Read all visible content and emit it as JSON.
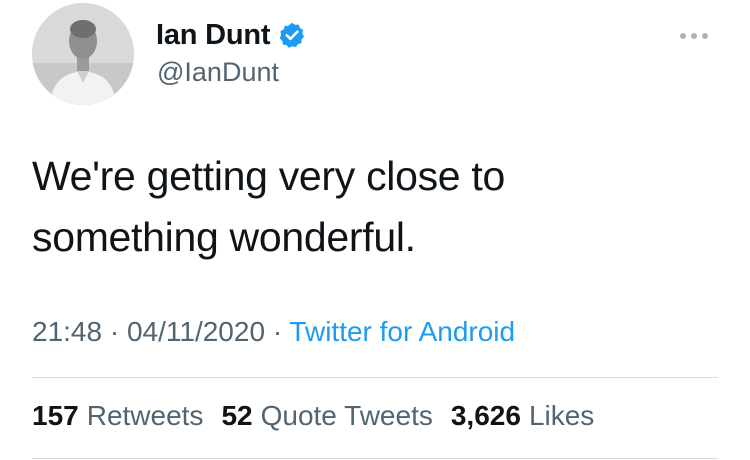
{
  "author": {
    "display_name": "Ian Dunt",
    "handle": "@IanDunt",
    "verified": true,
    "avatar_icon": "profile-photo-grayscale"
  },
  "tweet": {
    "text_lines": [
      "We're getting very close to",
      "something wonderful."
    ]
  },
  "meta": {
    "time": "21:48",
    "date": "04/11/2020",
    "separator": "·",
    "source": "Twitter for Android"
  },
  "stats": {
    "retweets_count": "157",
    "retweets_label": "Retweets",
    "quotes_count": "52",
    "quotes_label": "Quote Tweets",
    "likes_count": "3,626",
    "likes_label": "Likes"
  },
  "colors": {
    "link_blue": "#1d9bf0",
    "secondary_text": "#536471",
    "primary_text": "#0f1419",
    "verified_badge": "#1d9bf0"
  }
}
